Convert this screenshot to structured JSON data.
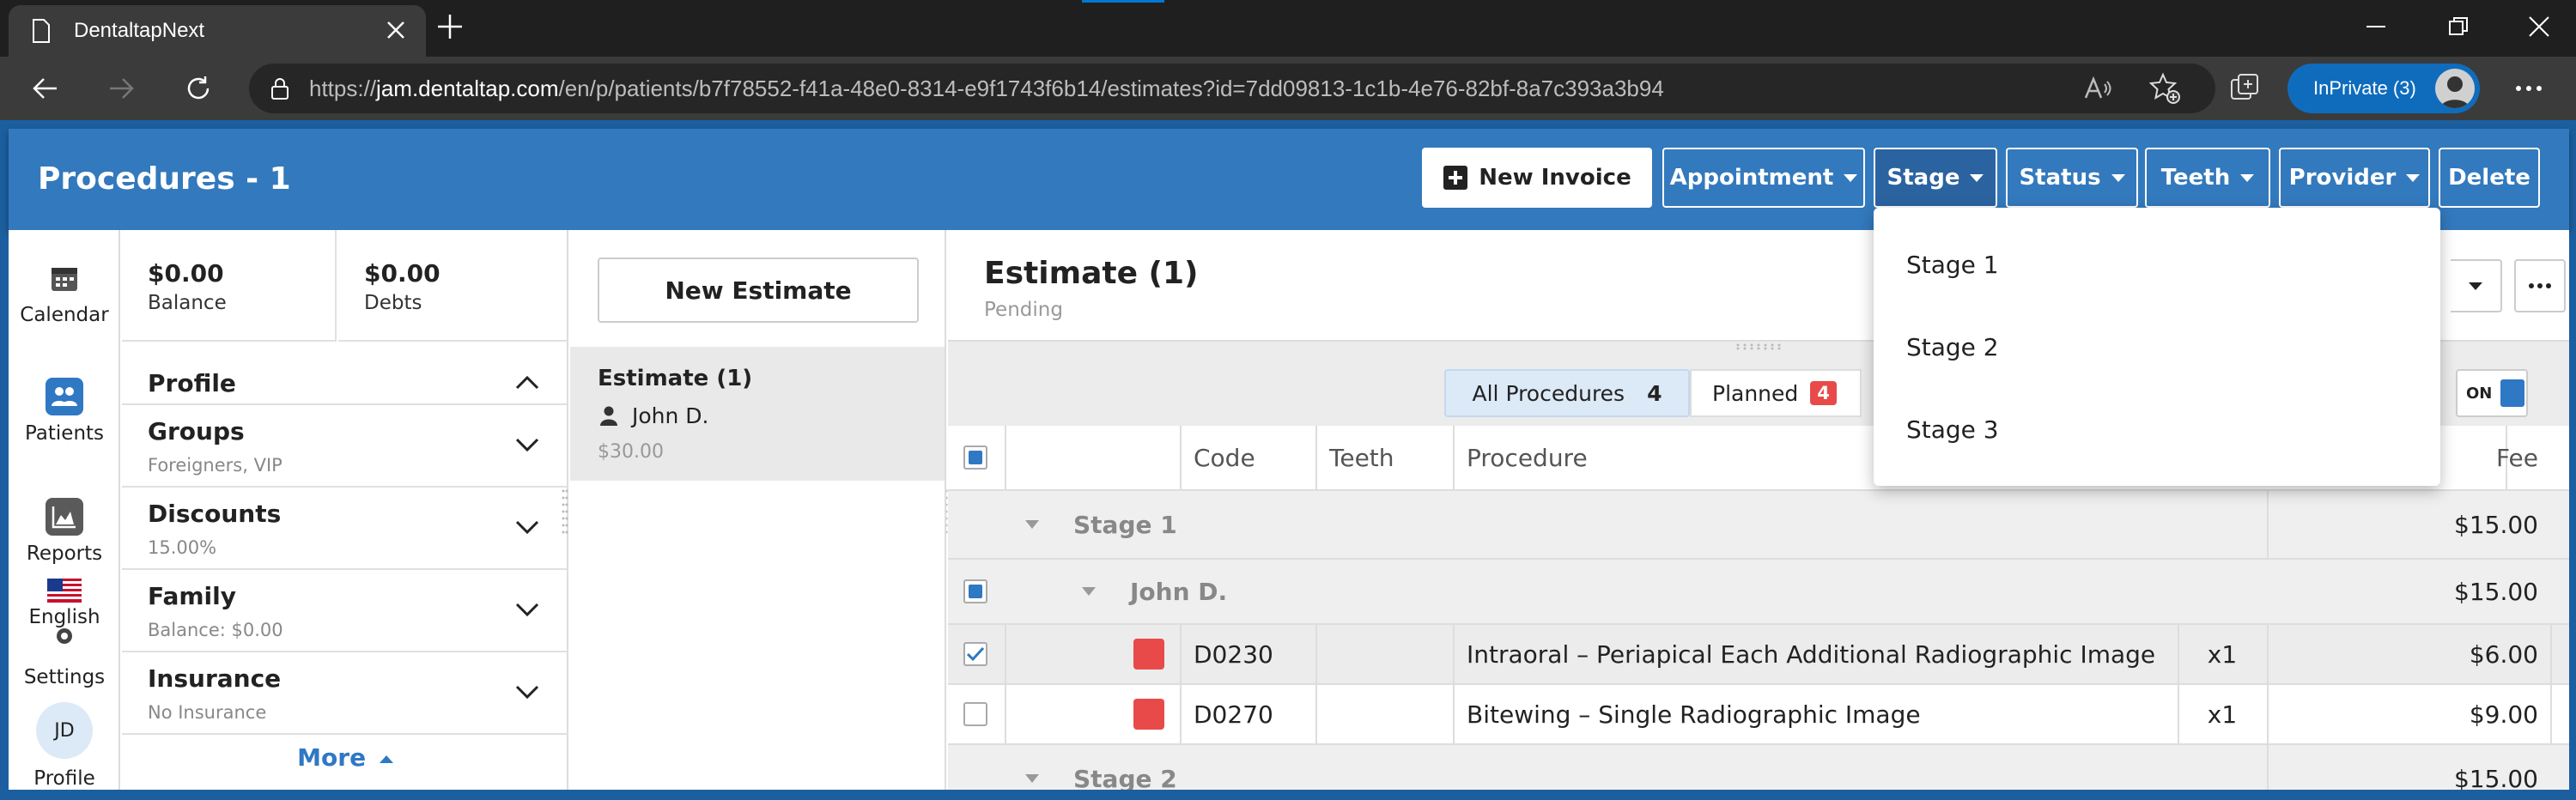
{
  "browser": {
    "tab_title": "DentaltapNext",
    "url_prefix": "https://",
    "url_host": "jam.dentaltap.com",
    "url_path": "/en/p/patients/b7f78552-f41a-48e0-8314-e9f1743f6b14/estimates?id=7dd09813-1c1b-4e76-82bf-8a7c393a3b94",
    "inprivate_label": "InPrivate (3)"
  },
  "header": {
    "title": "Procedures - 1",
    "buttons": {
      "new_invoice": "New Invoice",
      "appointment": "Appointment",
      "stage": "Stage",
      "status": "Status",
      "teeth": "Teeth",
      "provider": "Provider",
      "delete": "Delete"
    }
  },
  "nav": {
    "calendar": "Calendar",
    "patients": "Patients",
    "reports": "Reports",
    "english": "English",
    "settings": "Settings",
    "profile_initials": "JD",
    "profile": "Profile"
  },
  "profile": {
    "balance_value": "$0.00",
    "balance_label": "Balance",
    "debts_value": "$0.00",
    "debts_label": "Debts",
    "profile_heading": "Profile",
    "groups": {
      "label": "Groups",
      "value": "Foreigners, VIP"
    },
    "discounts": {
      "label": "Discounts",
      "value": "15.00%"
    },
    "family": {
      "label": "Family",
      "value": "Balance: $0.00"
    },
    "insurance": {
      "label": "Insurance",
      "value": "No Insurance"
    },
    "more": "More"
  },
  "estimates": {
    "new_button": "New Estimate",
    "card": {
      "title": "Estimate (1)",
      "patient": "John D.",
      "amount": "$30.00"
    }
  },
  "estimate": {
    "title": "Estimate (1)",
    "status": "Pending",
    "filters": {
      "all_label": "All Procedures",
      "all_count": "4",
      "planned_label": "Planned",
      "planned_count": "4"
    },
    "toggle_label": "ON",
    "columns": {
      "code": "Code",
      "teeth": "Teeth",
      "procedure": "Procedure",
      "fee": "Fee"
    },
    "stage1": {
      "label": "Stage 1",
      "total": "$15.00"
    },
    "patient_group": {
      "name": "John D.",
      "total": "$15.00"
    },
    "rows": [
      {
        "code": "D0230",
        "teeth": "",
        "procedure": "Intraoral – Periapical Each Additional Radiographic Image",
        "qty": "x1",
        "fee": "$6.00",
        "checked": true
      },
      {
        "code": "D0270",
        "teeth": "",
        "procedure": "Bitewing – Single Radiographic Image",
        "qty": "x1",
        "fee": "$9.00",
        "checked": false
      }
    ],
    "stage2": {
      "label": "Stage 2",
      "total": "$15.00"
    }
  },
  "stage_dropdown": {
    "options": [
      "Stage 1",
      "Stage 2",
      "Stage 3"
    ]
  },
  "colors": {
    "header_blue": "#3379bd",
    "accent_blue": "#2f78c4",
    "badge_red": "#e84a4a"
  }
}
